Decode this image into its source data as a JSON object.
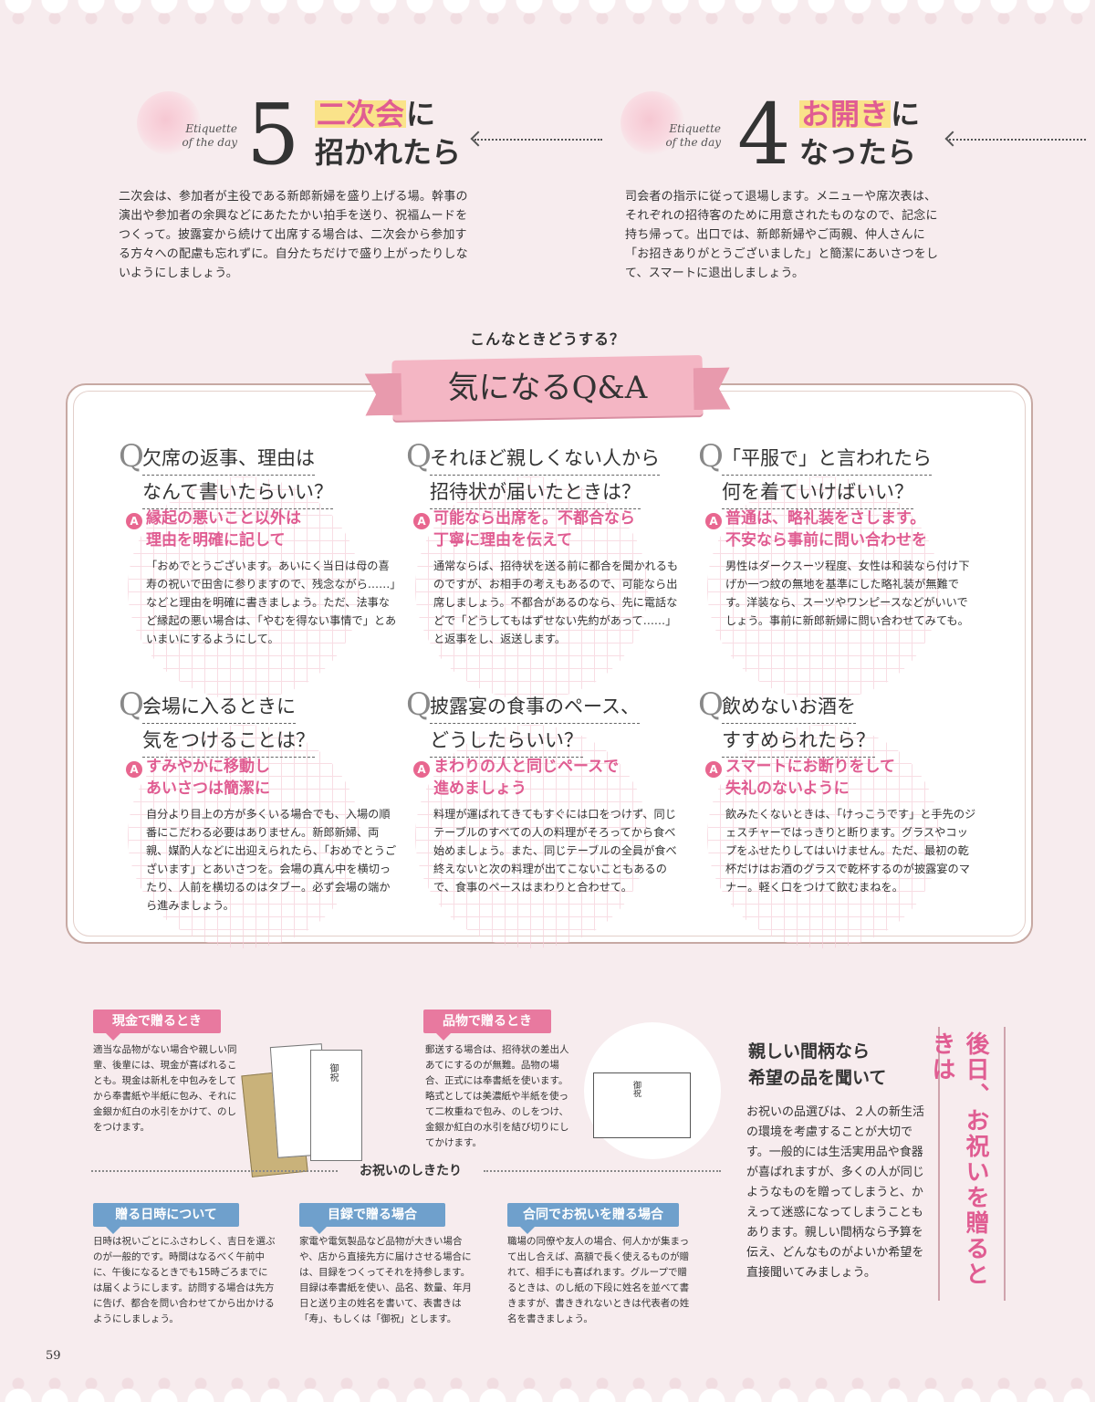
{
  "etiquette5": {
    "sub": "Etiquette\nof the day",
    "num": "5",
    "title_hl": "二次会",
    "title_rest": "に",
    "title_line2": "招かれたら",
    "body": "二次会は、参加者が主役である新郎新婦を盛り上げる場。幹事の演出や参加者の余興などにあたたかい拍手を送り、祝福ムードをつくって。披露宴から続けて出席する場合は、二次会から参加する方々への配慮も忘れずに。自分たちだけで盛り上がったりしないようにしましょう。"
  },
  "etiquette4": {
    "sub": "Etiquette\nof the day",
    "num": "4",
    "title_hl": "お開き",
    "title_rest": "に",
    "title_line2": "なったら",
    "body": "司会者の指示に従って退場します。メニューや席次表は、それぞれの招待客のために用意されたものなので、記念に持ち帰って。出口では、新郎新婦やご両親、仲人さんに「お招きありがとうございました」と簡潔にあいさつをして、スマートに退出しましょう。"
  },
  "qa": {
    "kicker": "こんなときどうする？",
    "heading": "気になるQ&A",
    "q_mark": "Q",
    "a_mark": "A",
    "items": [
      {
        "q1": "欠席の返事、理由は",
        "q2": "なんて書いたらいい？",
        "a1": "縁起の悪いこと以外は",
        "a2": "理由を明確に記して",
        "body": "「おめでとうございます。あいにく当日は母の喜寿の祝いで田舎に参りますので、残念ながら……」などと理由を明確に書きましょう。ただ、法事など縁起の悪い場合は、「やむを得ない事情で」とあいまいにするようにして。"
      },
      {
        "q1": "それほど親しくない人から",
        "q2": "招待状が届いたときは？",
        "a1": "可能なら出席を。不都合なら",
        "a2": "丁寧に理由を伝えて",
        "body": "通常ならば、招待状を送る前に都合を聞かれるものですが、お相手の考えもあるので、可能なら出席しましょう。不都合があるのなら、先に電話などで「どうしてもはずせない先約があって……」と返事をし、返送します。"
      },
      {
        "q1": "「平服で」と言われたら",
        "q2": "何を着ていけばいい？",
        "a1": "普通は、略礼装をさします。",
        "a2": "不安なら事前に問い合わせを",
        "body": "男性はダークスーツ程度、女性は和装なら付け下げか一つ紋の無地を基準にした略礼装が無難です。洋装なら、スーツやワンピースなどがいいでしょう。事前に新郎新婦に問い合わせてみても。"
      },
      {
        "q1": "会場に入るときに",
        "q2": "気をつけることは？",
        "a1": "すみやかに移動し",
        "a2": "あいさつは簡潔に",
        "body": "自分より目上の方が多くいる場合でも、入場の順番にこだわる必要はありません。新郎新婦、両親、媒酌人などに出迎えられたら、「おめでとうございます」とあいさつを。会場の真ん中を横切ったり、人前を横切るのはタブー。必ず会場の端から進みましょう。"
      },
      {
        "q1": "披露宴の食事のペース、",
        "q2": "どうしたらいい？",
        "a1": "まわりの人と同じペースで",
        "a2": "進めましょう",
        "body": "料理が運ばれてきてもすぐには口をつけず、同じテーブルのすべての人の料理がそろってから食べ始めましょう。また、同じテーブルの全員が食べ終えないと次の料理が出てこないこともあるので、食事のペースはまわりと合わせて。"
      },
      {
        "q1": "飲めないお酒を",
        "q2": "すすめられたら？",
        "a1": "スマートにお断りをして",
        "a2": "失礼のないように",
        "body": "飲みたくないときは、「けっこうです」と手先のジェスチャーではっきりと断ります。グラスやコップをふせたりしてはいけません。ただ、最初の乾杯だけはお酒のグラスで乾杯するのが披露宴のマナー。軽く口をつけて飲むまねを。"
      }
    ]
  },
  "bottom": {
    "cash_tag": "現金で贈るとき",
    "cash_body": "適当な品物がない場合や親しい同輩、後輩には、現金が喜ばれることも。現金は新札を中包みをしてから奉書紙や半紙に包み、それに金銀か紅白の水引をかけて、のしをつけます。",
    "goods_tag": "品物で贈るとき",
    "goods_body": "郵送する場合は、招待状の差出人あてにするのが無難。品物の場合、正式には奉書紙を使います。略式としては美濃紙や半紙を使って二枚重ねで包み、のしをつけ、金銀か紅白の水引を結び切りにしてかけます。",
    "shikitari": "お祝いのしきたり",
    "date_tag": "贈る日時について",
    "date_body": "日時は祝いごとにふさわしく、吉日を選ぶのが一般的です。時間はなるべく午前中に、午後になるときでも15時ごろまでには届くようにします。訪問する場合は先方に告げ、都合を問い合わせてから出かけるようにしましょう。",
    "catalog_tag": "目録で贈る場合",
    "catalog_body": "家電や電気製品など品物が大きい場合や、店から直接先方に届けさせる場合には、目録をつくってそれを持参します。目録は奉書紙を使い、品名、数量、年月日と送り主の姓名を書いて、表書きは「寿」、もしくは「御祝」とします。",
    "joint_tag": "合同でお祝いを贈る場合",
    "joint_body": "職場の同僚や友人の場合、何人かが集まって出し合えば、高額で長く使えるものが贈れて、相手にも喜ばれます。グループで贈るときは、のし紙の下段に姓名を並べて書きますが、書ききれないときは代表者の姓名を書きましょう。",
    "side_title": "後日、お祝いを贈るときは",
    "side_head": "親しい間柄なら\n希望の品を聞いて",
    "side_body": "お祝いの品選びは、２人の新生活の環境を考慮することが大切です。一般的には生活実用品や食器が喜ばれますが、多くの人が同じようなものを贈ってしまうと、かえって迷惑になってしまうこともあります。親しい間柄なら予算を伝え、どんなものがよいか希望を直接聞いてみましょう。",
    "env_label": "御祝",
    "gift_label": "御祝"
  },
  "page_number": "59"
}
